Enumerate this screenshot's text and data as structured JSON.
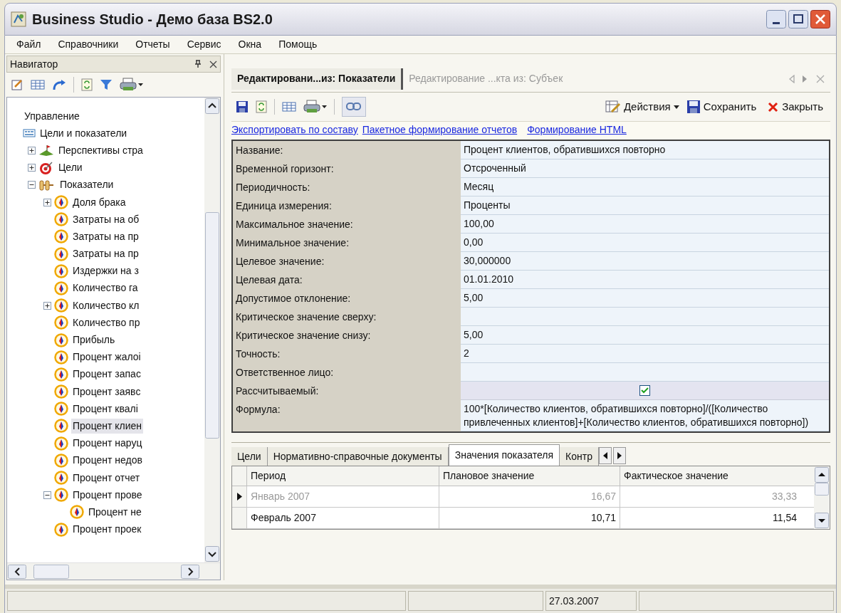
{
  "window": {
    "title": "Business Studio - Демо база BS2.0"
  },
  "menu": [
    "Файл",
    "Справочники",
    "Отчеты",
    "Сервис",
    "Окна",
    "Помощь"
  ],
  "navigator": {
    "title": "Навигатор",
    "tree": [
      {
        "label": "Управление",
        "kind": "plain",
        "selected": false
      },
      {
        "label": "Цели и показатели",
        "kind": "bsc",
        "selected": false,
        "children": [
          {
            "label": "Перспективы стра",
            "kind": "perspective",
            "selected": false,
            "expanded": false
          },
          {
            "label": "Цели",
            "kind": "goal",
            "selected": false,
            "expanded": false
          },
          {
            "label": "Показатели",
            "kind": "indicators",
            "selected": false,
            "expanded": true,
            "children": [
              {
                "label": "Доля брака",
                "kind": "indicator",
                "selected": false,
                "expanded": false
              },
              {
                "label": "Затраты на об",
                "kind": "indicator",
                "selected": false
              },
              {
                "label": "Затраты на пр",
                "kind": "indicator",
                "selected": false
              },
              {
                "label": "Затраты на пр",
                "kind": "indicator",
                "selected": false
              },
              {
                "label": "Издержки на з",
                "kind": "indicator",
                "selected": false
              },
              {
                "label": "Количество га",
                "kind": "indicator",
                "selected": false
              },
              {
                "label": "Количество кл",
                "kind": "indicator",
                "selected": false,
                "expanded": false
              },
              {
                "label": "Количество пр",
                "kind": "indicator",
                "selected": false
              },
              {
                "label": "Прибыль",
                "kind": "indicator",
                "selected": false
              },
              {
                "label": "Процент жалоі",
                "kind": "indicator",
                "selected": false
              },
              {
                "label": "Процент запас",
                "kind": "indicator",
                "selected": false
              },
              {
                "label": "Процент заявс",
                "kind": "indicator",
                "selected": false
              },
              {
                "label": "Процент квалі",
                "kind": "indicator",
                "selected": false
              },
              {
                "label": "Процент клиен",
                "kind": "indicator",
                "selected": true
              },
              {
                "label": "Процент наруц",
                "kind": "indicator",
                "selected": false
              },
              {
                "label": "Процент недов",
                "kind": "indicator",
                "selected": false
              },
              {
                "label": "Процент отчет",
                "kind": "indicator",
                "selected": false
              },
              {
                "label": "Процент прове",
                "kind": "indicator",
                "selected": false,
                "expanded": true,
                "children": [
                  {
                    "label": "Процент не",
                    "kind": "indicator",
                    "selected": false
                  }
                ]
              },
              {
                "label": "Процент проек",
                "kind": "indicator",
                "selected": false
              }
            ]
          }
        ]
      }
    ]
  },
  "doc_tabs": [
    {
      "label": "Редактировани...из: Показатели",
      "selected": true
    },
    {
      "label": "Редактирование ...кта из: Субъек",
      "selected": false
    }
  ],
  "toolbar": {
    "actions": "Действия",
    "save": "Сохранить",
    "close": "Закрыть"
  },
  "links": [
    "Экспортировать по составу",
    "Пакетное формирование отчетов",
    "Формирование HTML"
  ],
  "fields": [
    {
      "label": "Название:",
      "value": "Процент клиентов, обратившихся повторно",
      "kind": "text"
    },
    {
      "label": "Временной горизонт:",
      "value": "Отсроченный",
      "kind": "text"
    },
    {
      "label": "Периодичность:",
      "value": "Месяц",
      "kind": "text"
    },
    {
      "label": "Единица измерения:",
      "value": "Проценты",
      "kind": "text"
    },
    {
      "label": "Максимальное значение:",
      "value": "100,00",
      "kind": "text"
    },
    {
      "label": "Минимальное значение:",
      "value": "0,00",
      "kind": "text"
    },
    {
      "label": "Целевое значение:",
      "value": "30,000000",
      "kind": "text"
    },
    {
      "label": "Целевая дата:",
      "value": "01.01.2010",
      "kind": "text"
    },
    {
      "label": "Допустимое отклонение:",
      "value": "5,00",
      "kind": "text"
    },
    {
      "label": "Критическое значение сверху:",
      "kind": "text"
    },
    {
      "label": "Критическое значение снизу:",
      "value": "5,00",
      "kind": "text"
    },
    {
      "label": "Точность:",
      "value": "2",
      "kind": "text"
    },
    {
      "label": "Ответственное лицо:",
      "kind": "text"
    },
    {
      "label": "Рассчитываемый:",
      "kind": "checkbox",
      "checked": true
    },
    {
      "label": "Формула:",
      "value": "100*[Количество клиентов, обратившихся повторно]/([Количество привлеченных клиентов]+[Количество клиентов, обратившихся повторно])",
      "kind": "text"
    }
  ],
  "bottom_tabs": [
    {
      "label": "Цели",
      "selected": false
    },
    {
      "label": "Нормативно-справочные документы",
      "selected": false
    },
    {
      "label": "Значения показателя",
      "selected": true
    },
    {
      "label": "Контр",
      "selected": false
    }
  ],
  "table": {
    "columns": [
      "Период",
      "Плановое значение",
      "Фактическое значение"
    ],
    "rows": [
      {
        "cells": [
          "Январь 2007",
          "16,67",
          "33,33"
        ],
        "current": true
      },
      {
        "cells": [
          "Февраль 2007",
          "10,71",
          "11,54"
        ],
        "current": false
      }
    ]
  },
  "status_bar": [
    "27.03.2007"
  ]
}
